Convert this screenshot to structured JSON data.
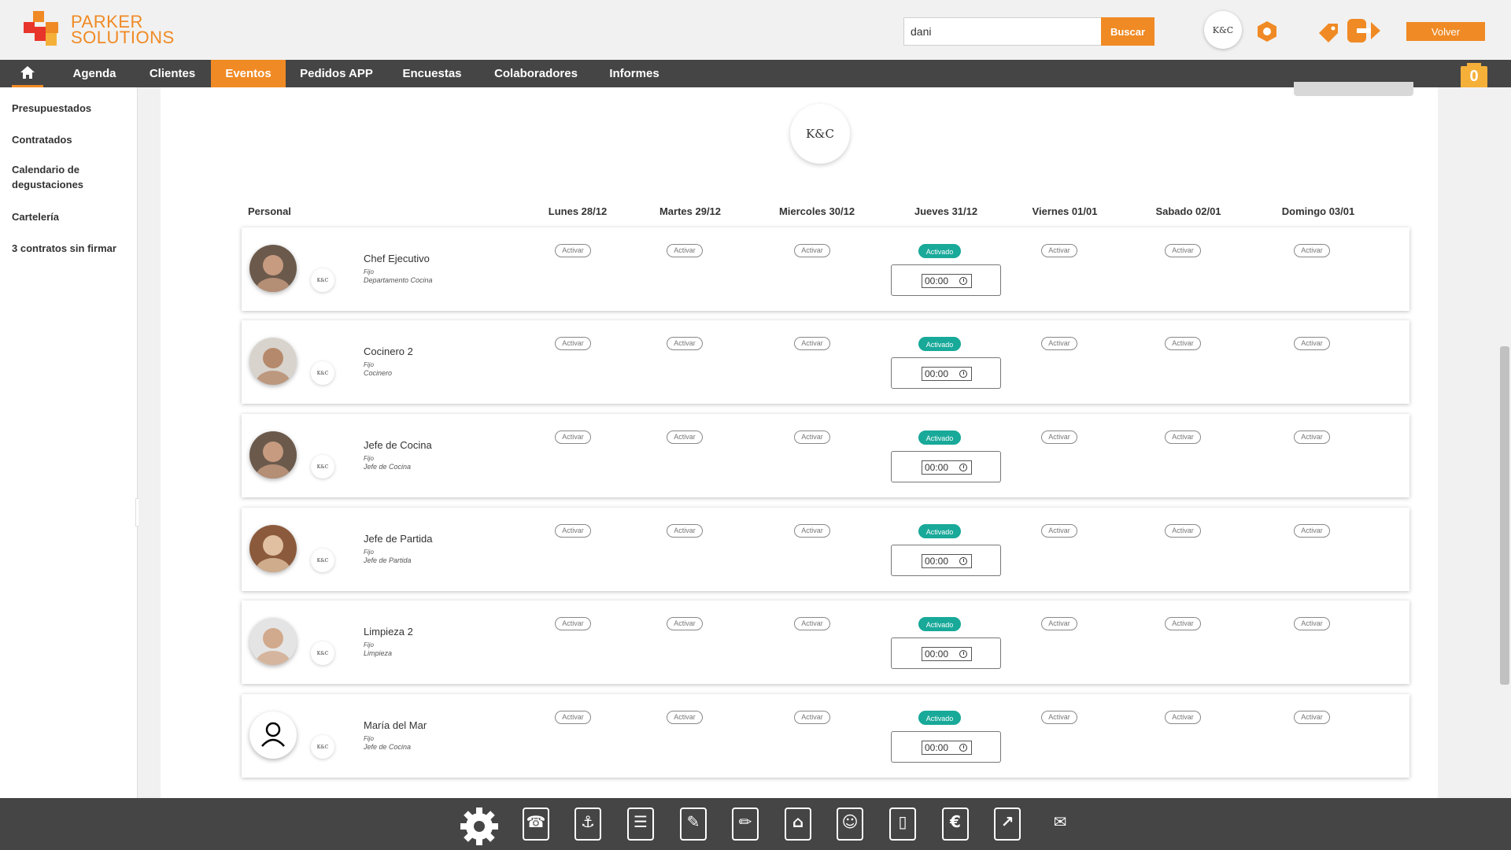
{
  "header": {
    "logo_line1": "PARKER",
    "logo_line2": "SOLUTIONS",
    "search_value": "dani",
    "search_button": "Buscar",
    "brand_initials": "K&C",
    "volver_label": "Volver",
    "cart_count": "0"
  },
  "nav": {
    "items": [
      "Agenda",
      "Clientes",
      "Eventos",
      "Pedidos APP",
      "Encuestas",
      "Colaboradores",
      "Informes"
    ],
    "active": "Eventos"
  },
  "sidebar": {
    "links": [
      "Presupuestados",
      "Contratados",
      "Calendario de degustaciones",
      "Cartelería",
      "3 contratos sin firmar"
    ]
  },
  "main": {
    "company_initials": "K&C",
    "col_personal": "Personal",
    "days": [
      "Lunes 28/12",
      "Martes 29/12",
      "Miercoles 30/12",
      "Jueves 31/12",
      "Viernes 01/01",
      "Sabado 02/01",
      "Domingo 03/01"
    ],
    "activar_label": "Activar",
    "activado_label": "Activado",
    "staff": [
      {
        "name": "Chef Ejecutivo",
        "type": "Fijo",
        "dept": "Departamento Cocina",
        "time": "00:00"
      },
      {
        "name": "Cocinero 2",
        "type": "Fijo",
        "dept": "Cocinero",
        "time": "00:00"
      },
      {
        "name": "Jefe de Cocina",
        "type": "Fijo",
        "dept": "Jefe de Cocina",
        "time": "00:00"
      },
      {
        "name": "Jefe de Partida",
        "type": "Fijo",
        "dept": "Jefe de Partida",
        "time": "00:00"
      },
      {
        "name": "Limpieza 2",
        "type": "Fijo",
        "dept": "Limpieza",
        "time": "00:00"
      },
      {
        "name": "María del Mar",
        "type": "Fijo",
        "dept": "Jefe de Cocina",
        "time": "00:00"
      }
    ]
  },
  "toolbar": {
    "icons": [
      "settings-icon",
      "support-icon",
      "handshake-icon",
      "menu-icon",
      "pen-icon",
      "marker-icon",
      "cart-icon",
      "staff-icon",
      "mobile-icon",
      "euro-icon",
      "chart-icon",
      "chat-icon"
    ]
  },
  "colors": {
    "accent": "#f08a24",
    "nav_bg": "#454545",
    "activated": "#18a999"
  }
}
